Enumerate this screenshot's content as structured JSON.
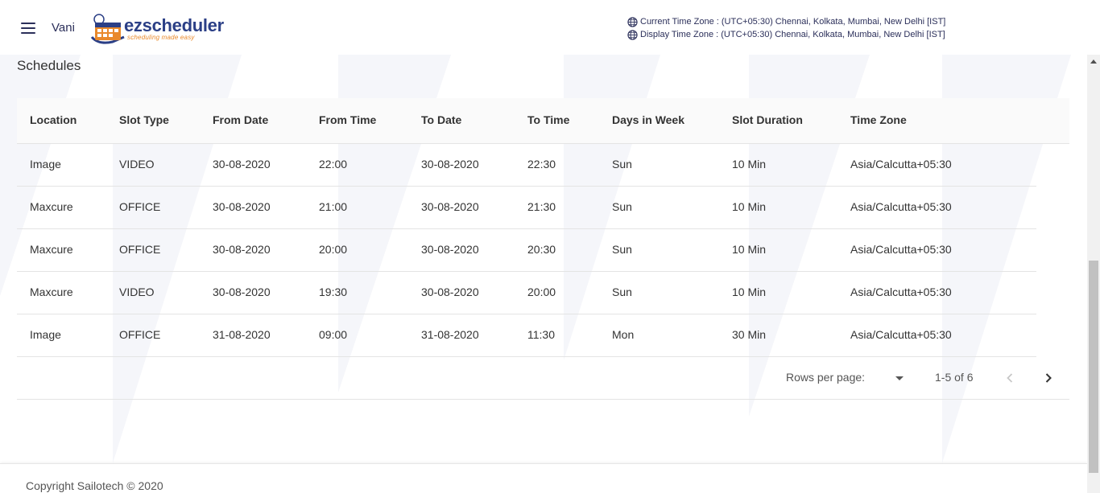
{
  "header": {
    "menu_icon": "hamburger-menu-icon",
    "user_name": "Vani",
    "logo": {
      "prefix": "ez",
      "name": "scheduler",
      "tagline": "scheduling made easy"
    },
    "timezones": {
      "current": "Current Time Zone : (UTC+05:30) Chennai, Kolkata, Mumbai, New Delhi [IST]",
      "display": "Display Time Zone : (UTC+05:30) Chennai, Kolkata, Mumbai, New Delhi [IST]"
    }
  },
  "page_title": "Schedules",
  "table": {
    "columns": [
      "Location",
      "Slot Type",
      "From Date",
      "From Time",
      "To Date",
      "To Time",
      "Days in Week",
      "Slot Duration",
      "Time Zone"
    ],
    "rows": [
      [
        "Image",
        "VIDEO",
        "30-08-2020",
        "22:00",
        "30-08-2020",
        "22:30",
        "Sun",
        "10 Min",
        "Asia/Calcutta+05:30"
      ],
      [
        "Maxcure",
        "OFFICE",
        "30-08-2020",
        "21:00",
        "30-08-2020",
        "21:30",
        "Sun",
        "10 Min",
        "Asia/Calcutta+05:30"
      ],
      [
        "Maxcure",
        "OFFICE",
        "30-08-2020",
        "20:00",
        "30-08-2020",
        "20:30",
        "Sun",
        "10 Min",
        "Asia/Calcutta+05:30"
      ],
      [
        "Maxcure",
        "VIDEO",
        "30-08-2020",
        "19:30",
        "30-08-2020",
        "20:00",
        "Sun",
        "10 Min",
        "Asia/Calcutta+05:30"
      ],
      [
        "Image",
        "OFFICE",
        "31-08-2020",
        "09:00",
        "31-08-2020",
        "11:30",
        "Mon",
        "30 Min",
        "Asia/Calcutta+05:30"
      ]
    ]
  },
  "pagination": {
    "rows_per_page_label": "Rows per page:",
    "rows_per_page_value": "",
    "range": "1-5 of 6",
    "prev_icon": "chevron-left-icon",
    "next_icon": "chevron-right-icon"
  },
  "footer": {
    "copyright": "Copyright Sailotech © 2020"
  },
  "colors": {
    "brand_navy": "#2b3f86",
    "brand_orange": "#e9892b",
    "text": "#333333",
    "divider": "#e4e4e4"
  }
}
